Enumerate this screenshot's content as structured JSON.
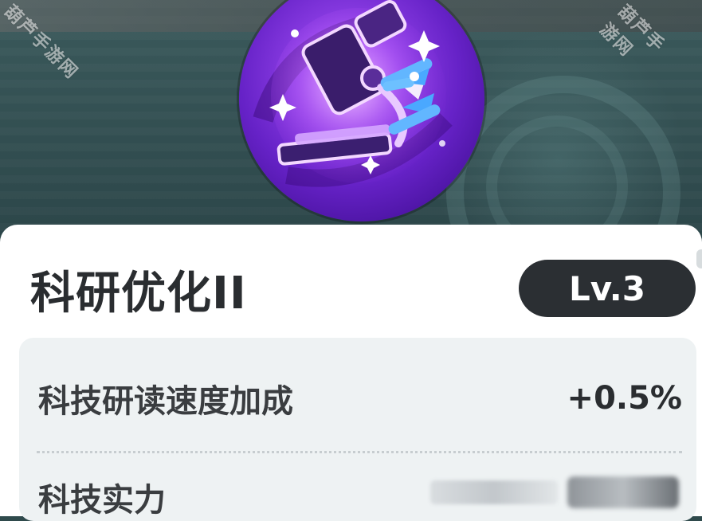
{
  "watermark": {
    "text": "葫芦手游网"
  },
  "skill": {
    "icon": "microscope-hourglass-icon",
    "title": "科研优化II",
    "level": "Lv.3"
  },
  "stats": [
    {
      "label": "科技研读速度加成",
      "value": "+0.5%"
    },
    {
      "label": "科技实力",
      "value": ""
    }
  ],
  "colors": {
    "badge_bg": "#2b2f33",
    "card_bg": "#ffffff",
    "panel_bg": "#eef2f3",
    "icon_purple": "#8e3fe6",
    "hourglass_blue": "#4aa8ff"
  }
}
